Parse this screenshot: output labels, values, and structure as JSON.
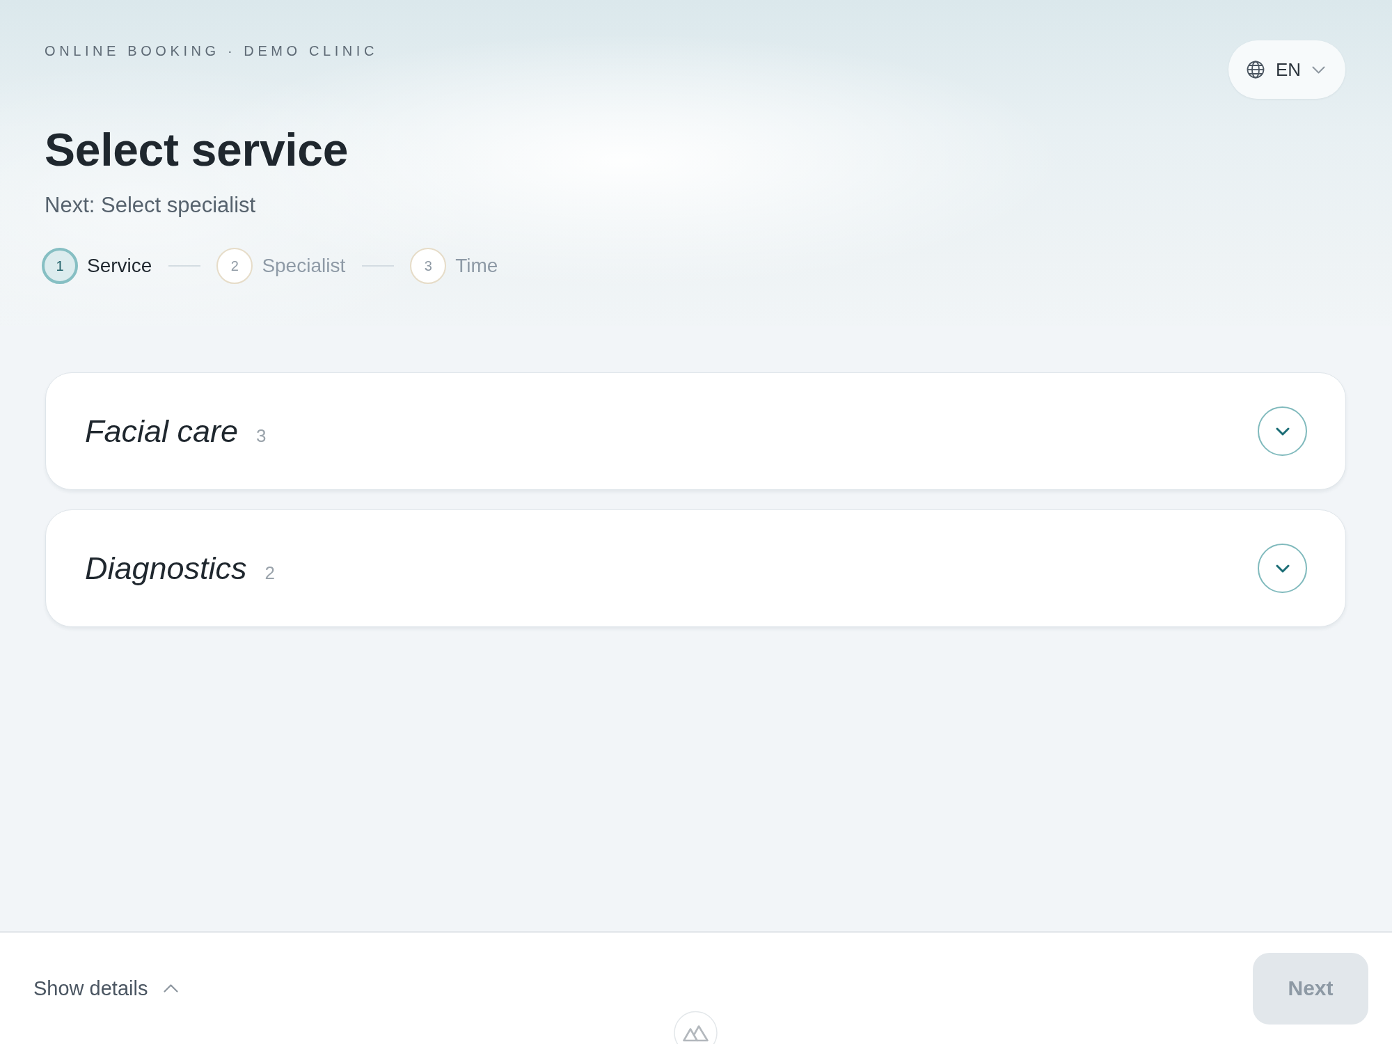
{
  "header": {
    "eyebrow": "ONLINE BOOKING · DEMO CLINIC",
    "title": "Select service",
    "subtitle": "Next: Select specialist",
    "language": {
      "label": "EN"
    }
  },
  "steps": [
    {
      "number": "1",
      "label": "Service",
      "selected": true
    },
    {
      "number": "2",
      "label": "Specialist",
      "selected": false
    },
    {
      "number": "3",
      "label": "Time",
      "selected": false
    }
  ],
  "categories": [
    {
      "name": "Facial care",
      "count": "3",
      "expanded": false
    },
    {
      "name": "Diagnostics",
      "count": "2",
      "expanded": false
    }
  ],
  "footer": {
    "details_toggle": "Show details",
    "next_button": {
      "label": "Next",
      "disabled": true
    }
  }
}
